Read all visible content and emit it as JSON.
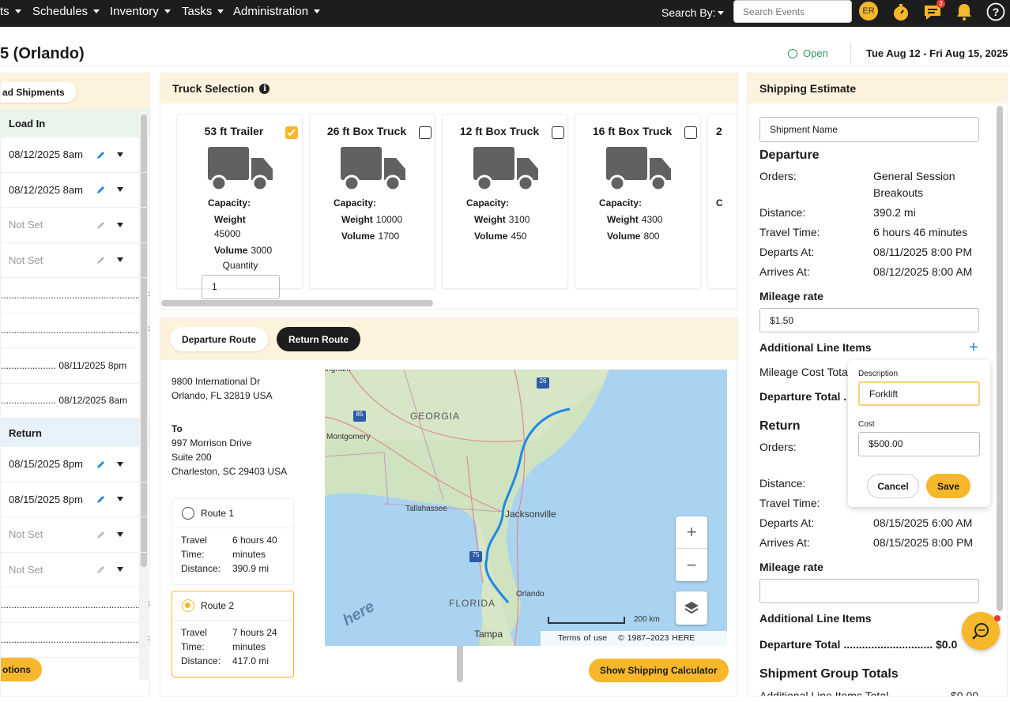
{
  "nav": {
    "items": [
      "ts",
      "Schedules",
      "Inventory",
      "Tasks",
      "Administration"
    ],
    "search_by": "Search By:",
    "search_placeholder": "Search Events",
    "avatar": "ER",
    "chat_badge": "3"
  },
  "header": {
    "title": "5 (Orlando)",
    "status": "Open",
    "date_range": "Tue Aug 12 - Fri Aug 15, 2025"
  },
  "left": {
    "pill": "ad Shipments",
    "load_in_label": "Load In",
    "load_in_rows": [
      {
        "text": "08/12/2025 8am",
        "muted": false
      },
      {
        "text": "08/12/2025 8am",
        "muted": false
      },
      {
        "text": "Not Set",
        "muted": true
      },
      {
        "text": "Not Set",
        "muted": true
      }
    ],
    "load_in_dots": [
      "...................................................... ???",
      "...................................................... ???",
      "..................... 08/11/2025 8pm",
      "..................... 08/12/2025 8am"
    ],
    "return_label": "Return",
    "return_rows": [
      {
        "text": "08/15/2025 8pm",
        "muted": false
      },
      {
        "text": "08/15/2025 8pm",
        "muted": false
      },
      {
        "text": "Not Set",
        "muted": true
      },
      {
        "text": "Not Set",
        "muted": true
      }
    ],
    "return_dots": [
      "...................................................... ???",
      "...................................................... ???"
    ],
    "options_button": "otions"
  },
  "truck": {
    "title": "Truck Selection",
    "capacity_label": "Capacity:",
    "weight_label": "Weight",
    "volume_label": "Volume",
    "quantity_label": "Quantity",
    "cards": [
      {
        "name": "53 ft Trailer",
        "checked": true,
        "weight": "45000",
        "volume": "3000",
        "quantity": "1"
      },
      {
        "name": "26 ft Box Truck",
        "checked": false,
        "weight": "10000",
        "volume": "1700"
      },
      {
        "name": "12 ft Box Truck",
        "checked": false,
        "weight": "3100",
        "volume": "450"
      },
      {
        "name": "16 ft Box Truck",
        "checked": false,
        "weight": "4300",
        "volume": "800"
      },
      {
        "name": "2",
        "checked": false
      }
    ]
  },
  "route": {
    "tab_departure": "Departure Route",
    "tab_return": "Return Route",
    "from_line1": "9800 International Dr",
    "from_line2": "Orlando, FL 32819 USA",
    "to_label": "To",
    "to_line1": "997 Morrison Drive",
    "to_line2": "Suite 200",
    "to_line3": "Charleston, SC 29403 USA",
    "travel_label": "Travel",
    "time_label": "Time:",
    "distance_label": "Distance:",
    "routes": [
      {
        "name": "Route 1",
        "selected": false,
        "time1": "6 hours 40",
        "time2": "minutes",
        "distance": "390.9 mi"
      },
      {
        "name": "Route 2",
        "selected": true,
        "time1": "7 hours 24",
        "time2": "minutes",
        "distance": "417.0 mi"
      }
    ],
    "map": {
      "labels": [
        "GEORGIA",
        "Montgomery",
        "Tallahassee",
        "Jacksonville",
        "FLORIDA",
        "Orlando",
        "Tampa",
        "ingham"
      ],
      "shields": [
        "26",
        "85",
        "75"
      ],
      "scale": "200 km",
      "terms": "Terms of use",
      "copyright": "© 1987–2023 HERE",
      "watermark": "here"
    },
    "calc_button": "Show Shipping Calculator"
  },
  "estimate": {
    "title": "Shipping Estimate",
    "shipment_name_placeholder": "Shipment Name",
    "departure": {
      "heading": "Departure",
      "orders_label": "Orders:",
      "orders": [
        "General Session",
        "Breakouts"
      ],
      "distance_label": "Distance:",
      "distance": "390.2 mi",
      "travel_label": "Travel Time:",
      "travel": "6 hours 46 minutes",
      "departs_label": "Departs At:",
      "departs": "08/11/2025 8:00 PM",
      "arrives_label": "Arrives At:",
      "arrives": "08/12/2025 8:00 AM",
      "mileage_label": "Mileage rate",
      "mileage": "$1.50",
      "line_items_label": "Additional Line Items",
      "mileage_cost_label": "Mileage Cost Tota",
      "total_label": "Departure Total ."
    },
    "return": {
      "heading": "Return",
      "orders_label": "Orders:",
      "distance_label": "Distance:",
      "travel_label": "Travel Time:",
      "departs_label": "Departs At:",
      "departs": "08/15/2025 6:00 AM",
      "arrives_label": "Arrives At:",
      "arrives": "08/15/2025 8:00 PM",
      "mileage_label": "Mileage rate",
      "line_items_label": "Additional Line Items",
      "total_label": "Departure Total .............................",
      "total_value": "$0.0"
    },
    "group_totals": "Shipment Group Totals",
    "group_line": "Additional Line Items Total",
    "group_value": "$0.00"
  },
  "popup": {
    "description_label": "Description",
    "description_value": "Forklift",
    "cost_label": "Cost",
    "cost_value": "$500.00",
    "cancel": "Cancel",
    "save": "Save"
  },
  "colors": {
    "accent": "#f6b72a",
    "topbar": "#1d1d1d",
    "panel_header": "#fdf3dc",
    "link_blue": "#1e88e5",
    "status_green": "#2e9a5a"
  }
}
